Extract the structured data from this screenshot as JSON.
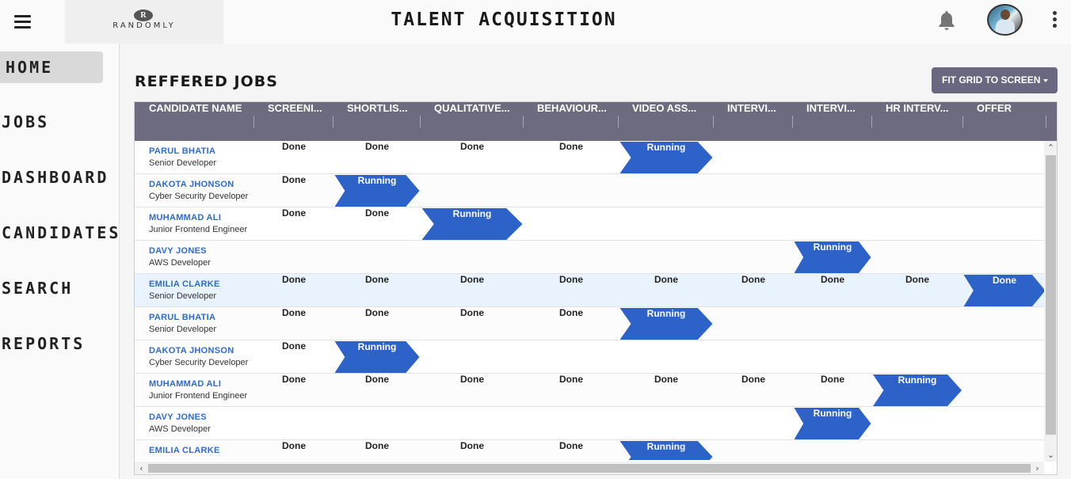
{
  "header": {
    "logo_mark": "R",
    "logo_text": "RANDOMLY",
    "title": "TALENT ACQUISITION",
    "icons": [
      "menu-icon",
      "bell-icon",
      "avatar",
      "more-vertical-icon"
    ]
  },
  "sidebar": {
    "items": [
      {
        "label": "HOME",
        "active": true
      },
      {
        "label": "JOBS",
        "active": false
      },
      {
        "label": "DASHBOARD",
        "active": false
      },
      {
        "label": "CANDIDATES",
        "active": false
      },
      {
        "label": "SEARCH",
        "active": false
      },
      {
        "label": "REPORTS",
        "active": false
      }
    ]
  },
  "main": {
    "section_title": "REFFERED JOBS",
    "fit_button": "FIT GRID TO SCREEN",
    "columns": [
      "CANDIDATE NAME",
      "SCREENI...",
      "SHORTLIS...",
      "QUALITATIVE...",
      "BEHAVIOUR...",
      "VIDEO ASS...",
      "INTERVI...",
      "INTERVI...",
      "HR INTERV...",
      "OFFER"
    ],
    "rows": [
      {
        "name": "PARUL BHATIA",
        "role": "Senior Developer",
        "stages": [
          "Done",
          "Done",
          "Done",
          "Done",
          "Running",
          "",
          "",
          "",
          ""
        ]
      },
      {
        "name": "DAKOTA JHONSON",
        "role": "Cyber Security Developer",
        "stages": [
          "Done",
          "Running",
          "",
          "",
          "",
          "",
          "",
          "",
          ""
        ]
      },
      {
        "name": "MUHAMMAD ALI",
        "role": "Junior Frontend Engineer",
        "stages": [
          "Done",
          "Done",
          "Running",
          "",
          "",
          "",
          "",
          "",
          ""
        ]
      },
      {
        "name": "DAVY JONES",
        "role": "AWS Developer",
        "stages": [
          "",
          "",
          "",
          "",
          "",
          "",
          "Running",
          "",
          ""
        ]
      },
      {
        "name": "EMILIA CLARKE",
        "role": "Senior Developer",
        "selected": true,
        "stages": [
          "Done",
          "Done",
          "Done",
          "Done",
          "Done",
          "Done",
          "Done",
          "Done",
          "Done"
        ]
      },
      {
        "name": "PARUL BHATIA",
        "role": "Senior Developer",
        "stages": [
          "Done",
          "Done",
          "Done",
          "Done",
          "Running",
          "",
          "",
          "",
          ""
        ]
      },
      {
        "name": "DAKOTA JHONSON",
        "role": "Cyber Security Developer",
        "stages": [
          "Done",
          "Running",
          "",
          "",
          "",
          "",
          "",
          "",
          ""
        ]
      },
      {
        "name": "MUHAMMAD ALI",
        "role": "Junior Frontend Engineer",
        "stages": [
          "Done",
          "Done",
          "Done",
          "Done",
          "Done",
          "Done",
          "Done",
          "Running",
          ""
        ]
      },
      {
        "name": "DAVY JONES",
        "role": "AWS Developer",
        "stages": [
          "",
          "",
          "",
          "",
          "",
          "",
          "Running",
          "",
          ""
        ]
      },
      {
        "name": "EMILIA CLARKE",
        "role": "",
        "stages": [
          "Done",
          "Done",
          "Done",
          "Done",
          "Running",
          "",
          "",
          "",
          ""
        ]
      }
    ]
  },
  "colors": {
    "header_bg": "#6d6b7f",
    "running": "#2d63c8",
    "link": "#2e6bd1",
    "selected_row": "#e8f3fd"
  }
}
